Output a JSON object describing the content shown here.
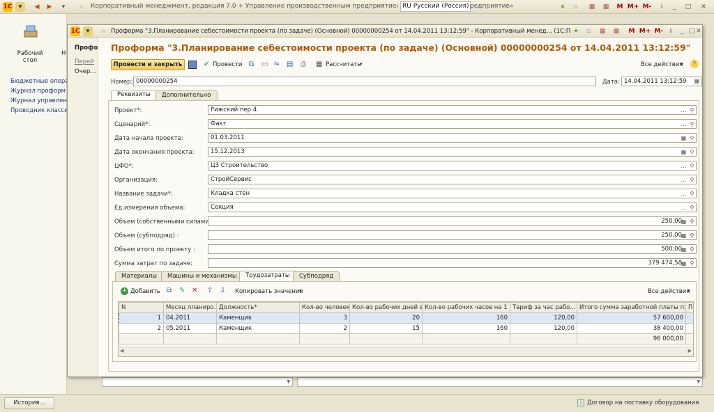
{
  "outer": {
    "title": "Корпоративный менеджмент, редакция 7.0 + Управление производственным предприятием, редакция 1.3",
    "lang": "RU Русский (Россия)",
    "suffix": "редприятие»"
  },
  "left": {
    "desk": "Рабочий\nстол",
    "h_letter": "Н",
    "links": [
      "Бюджетные операц",
      "Журнал проформ",
      "Журнал управлени",
      "Проводник классиф"
    ]
  },
  "inner": {
    "title": "Проформа \"3.Планирование себестоимости проекта (по задаче) (Основной) 00000000254 от 14.04.2011 13:12:59\" - Корпоративный менед...   (1С:Предприятие)",
    "nav": [
      "Профо",
      "Перей",
      "Очер..."
    ],
    "heading": "Проформа \"3.Планирование себестоимости проекта (по задаче) (Основной)  00000000254 от 14.04.2011 13:12:59\"",
    "toolbar": {
      "post_close": "Провести и закрыть",
      "post": "Провести",
      "calc": "Рассчитать",
      "all_actions": "Все действия"
    },
    "number_label": "Номер:",
    "number": "00000000254",
    "date_label": "Дата:",
    "date": "14.04.2011 13:12:59",
    "tabs": [
      "Реквизиты",
      "Дополнительно"
    ],
    "fields": [
      {
        "label": "Проект*:",
        "value": "Рижский пер.4"
      },
      {
        "label": "Сценарий*:",
        "value": "Факт"
      },
      {
        "label": "Дата начала проекта:",
        "value": "01.03.2011"
      },
      {
        "label": "Дата окончания проекта:",
        "value": "15.12.2013"
      },
      {
        "label": "ЦФО*:",
        "value": "ЦЗ Строительство"
      },
      {
        "label": "Организация:",
        "value": "СтройСервис"
      },
      {
        "label": "Название задачи*:",
        "value": "Кладка стен"
      },
      {
        "label": "Ед.измерения объема:",
        "value": "Секция"
      },
      {
        "label": "Объем (собственными силами):",
        "value": "250,00"
      },
      {
        "label": "Объем (субподряд) :",
        "value": "250,00"
      },
      {
        "label": "Объем итого по проекту :",
        "value": "500,00"
      },
      {
        "label": "Сумма затрат по задаче:",
        "value": "379 474,58"
      }
    ],
    "subtabs": [
      "Материалы",
      "Машины и механизмы",
      "Трудозатраты",
      "Субподряд"
    ],
    "subtoolbar": {
      "add": "Добавить",
      "copy": "Копировать значение",
      "all": "Все действия"
    },
    "table": {
      "headers": [
        "N",
        "Месяц планиро...",
        "Должность*",
        "Кол-во человек*",
        "Кол-во рабочих дней в...",
        "Кол-во рабочих часов на 1 с...",
        "Тариф за час рабо...",
        "Итого сумма заработной платы п...",
        "П"
      ],
      "rows": [
        [
          "1",
          "04.2011",
          "Каменщик",
          "3",
          "20",
          "160",
          "120,00",
          "57 600,00"
        ],
        [
          "2",
          "05.2011",
          "Каменщик",
          "2",
          "15",
          "160",
          "120,00",
          "38 400,00"
        ]
      ],
      "total": "96 000,00"
    }
  },
  "status": {
    "history": "История...",
    "contract": "Договор на поставку оборудования"
  }
}
